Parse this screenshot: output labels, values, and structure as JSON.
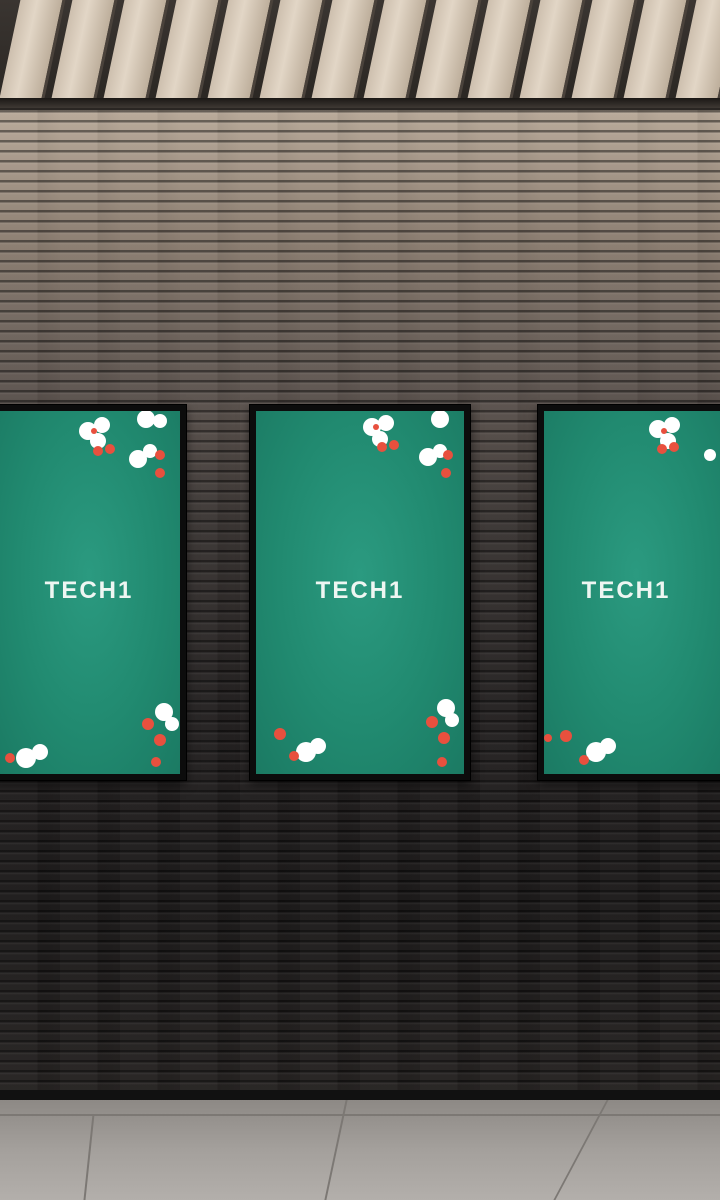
{
  "signs": [
    {
      "logo_text": "TECH1"
    },
    {
      "logo_text": "TECH1"
    },
    {
      "logo_text": "TECH1"
    }
  ],
  "colors": {
    "sign_background": "#238c72",
    "logo": "#eef6f2",
    "flower_white": "#ffffff",
    "flower_red": "#e8503e"
  }
}
